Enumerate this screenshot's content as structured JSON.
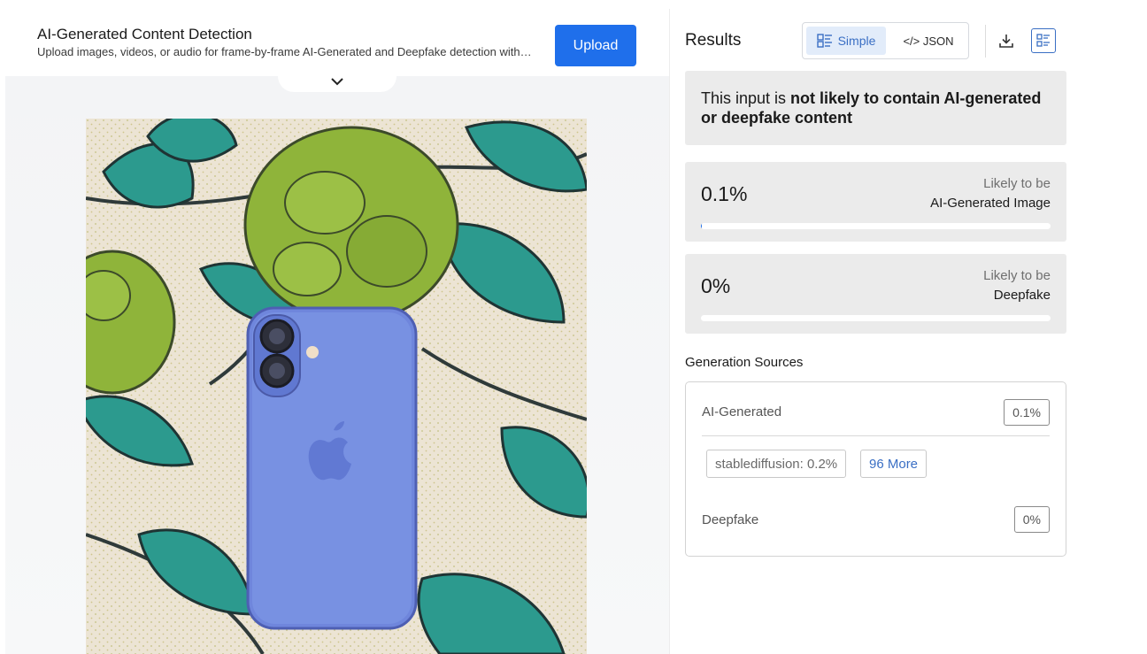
{
  "header": {
    "title": "AI-Generated Content Detection",
    "subtitle": "Upload images, videos, or audio for frame-by-frame AI-Generated and Deepfake detection with…",
    "upload_label": "Upload"
  },
  "results": {
    "title": "Results",
    "view_simple": "Simple",
    "view_json": "</> JSON",
    "verdict_prefix": "This input is ",
    "verdict_bold": "not likely to contain AI-generated or deepfake content",
    "scores": [
      {
        "value": "0.1%",
        "fraction": 0.001,
        "label_top": "Likely to be",
        "label_bottom": "AI-Generated Image"
      },
      {
        "value": "0%",
        "fraction": 0.0,
        "label_top": "Likely to be",
        "label_bottom": "Deepfake"
      }
    ]
  },
  "generation_sources": {
    "title": "Generation Sources",
    "ai_label": "AI-Generated",
    "ai_value": "0.1%",
    "chip_source": "stablediffusion: 0.2%",
    "chip_more": "96 More",
    "deepfake_label": "Deepfake",
    "deepfake_value": "0%"
  },
  "colors": {
    "accent": "#1f6feb",
    "phone": "#6f86dc",
    "leaf_green": "#8fb43a",
    "leaf_teal": "#2c9a8e"
  }
}
